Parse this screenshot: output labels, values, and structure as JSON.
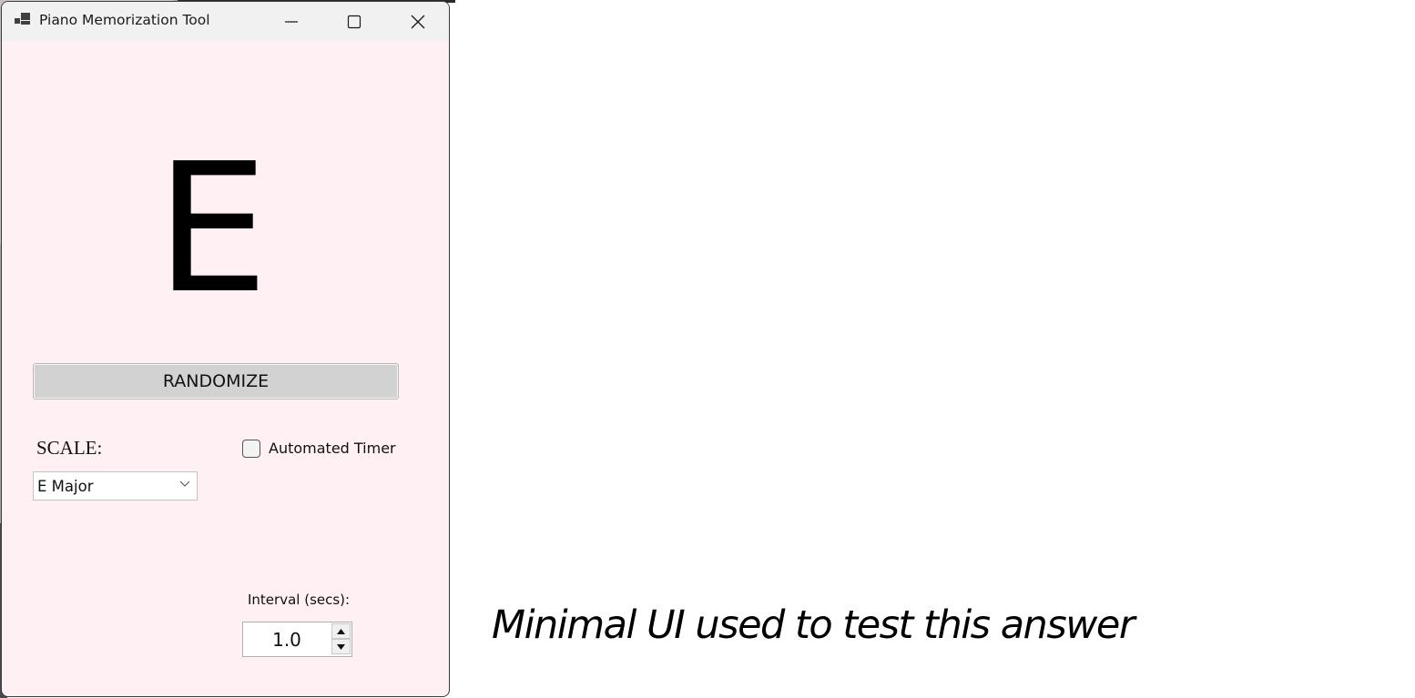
{
  "window": {
    "title": "Piano Memorization Tool",
    "icon": "app-window-icon",
    "controls": {
      "minimize": "minimize-icon",
      "maximize": "maximize-icon",
      "close": "close-icon"
    },
    "background_color": "#fff0f4"
  },
  "main": {
    "current_note": "E",
    "randomize_label": "RANDOMIZE",
    "scale_label": "SCALE:",
    "scale_selected": "E Major",
    "automated_timer_label": "Automated Timer",
    "automated_timer_checked": false,
    "interval_label": "Interval (secs):",
    "interval_value": "1.0"
  },
  "caption": "Minimal UI used to test this answer"
}
